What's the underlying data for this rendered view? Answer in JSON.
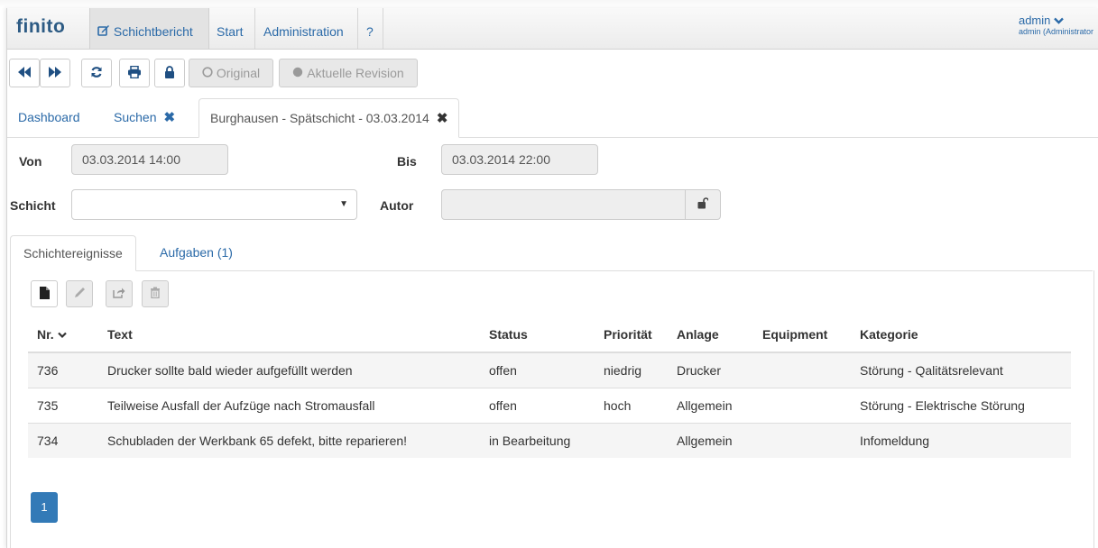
{
  "navbar": {
    "brand": "finito",
    "items": [
      {
        "label": "Schichtbericht",
        "icon": "edit-icon"
      },
      {
        "label": "Start"
      },
      {
        "label": "Administration"
      },
      {
        "label": "?"
      }
    ],
    "user": {
      "name": "admin",
      "role": "admin (Administrator"
    }
  },
  "toolbar": {
    "original_label": "Original",
    "revision_label": "Aktuelle Revision"
  },
  "tabs": [
    {
      "label": "Dashboard"
    },
    {
      "label": "Suchen"
    },
    {
      "label": "Burghausen - Spätschicht - 03.03.2014"
    }
  ],
  "form": {
    "von_label": "Von",
    "von_value": "03.03.2014 14:00",
    "bis_label": "Bis",
    "bis_value": "03.03.2014 22:00",
    "schicht_label": "Schicht",
    "schicht_value": "",
    "autor_label": "Autor",
    "autor_value": ""
  },
  "subtabs": [
    {
      "label": "Schichtereignisse"
    },
    {
      "label": "Aufgaben (1)"
    }
  ],
  "table": {
    "headers": [
      "Nr.",
      "Text",
      "Status",
      "Priorität",
      "Anlage",
      "Equipment",
      "Kategorie"
    ],
    "rows": [
      [
        "736",
        "Drucker sollte bald wieder aufgefüllt werden",
        "offen",
        "niedrig",
        "Drucker",
        "",
        "Störung - Qalitätsrelevant"
      ],
      [
        "735",
        "Teilweise Ausfall der Aufzüge nach Stromausfall",
        "offen",
        "hoch",
        "Allgemein",
        "",
        "Störung - Elektrische Störung"
      ],
      [
        "734",
        "Schubladen der Werkbank 65 defekt, bitte reparieren!",
        "in Bearbeitung",
        "",
        "Allgemein",
        "",
        "Infomeldung"
      ]
    ]
  },
  "pagination": {
    "current": "1"
  },
  "colors": {
    "accent": "#2b6aa8",
    "brand": "#2d5b84",
    "pager": "#337ab7"
  }
}
